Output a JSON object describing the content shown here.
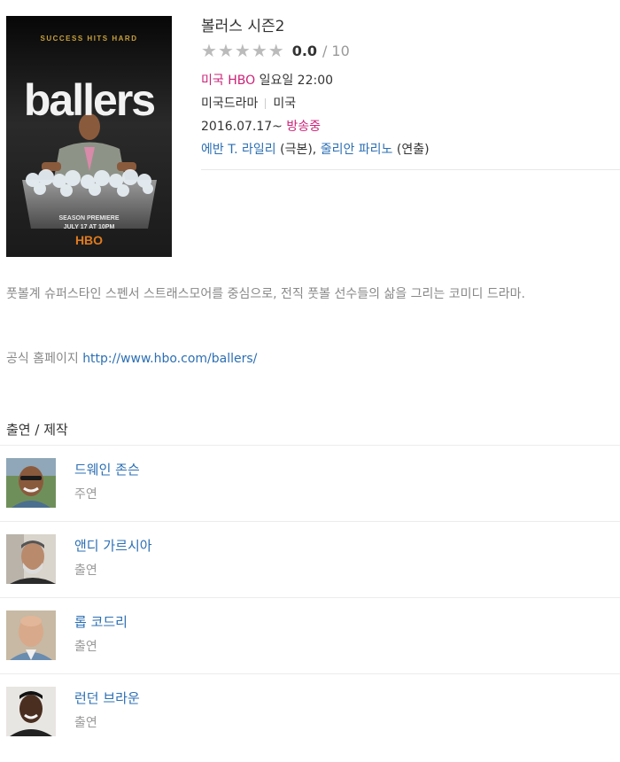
{
  "show": {
    "title": "볼러스 시즌2",
    "rating": "0.0",
    "rating_sep": "/",
    "rating_max": "10",
    "network": "미국 HBO",
    "schedule": "일요일 22:00",
    "genre": "미국드라마",
    "country": "미국",
    "date": "2016.07.17~",
    "status": "방송중",
    "writer": "에반 T. 라일리",
    "writer_role": "(극본)",
    "comma": ",",
    "director": "줄리안 파리노",
    "director_role": "(연출)"
  },
  "poster": {
    "tagline": "SUCCESS HITS HARD",
    "logo": "ballers",
    "premiere_1": "SEASON PREMIERE",
    "premiere_2": "JULY 17 AT 10PM",
    "network_logo": "HBO"
  },
  "description": "풋볼계 슈퍼스타인 스펜서 스트래스모어를 중심으로, 전직 풋볼 선수들의 삶을 그리는 코미디 드라마.",
  "homepage": {
    "label": "공식 홈페이지",
    "url": "http://www.hbo.com/ballers/"
  },
  "cast_section_title": "출연 / 제작",
  "cast": [
    {
      "name": "드웨인 존슨",
      "role": "주연"
    },
    {
      "name": "앤디 가르시아",
      "role": "출연"
    },
    {
      "name": "롭 코드리",
      "role": "출연"
    },
    {
      "name": "런던 브라운",
      "role": "출연"
    }
  ],
  "colors": {
    "link_blue": "#2c6fb4",
    "accent_pink": "#cc2277",
    "poster_gold": "#c9a13a",
    "hbo_orange": "#e07b1e"
  }
}
